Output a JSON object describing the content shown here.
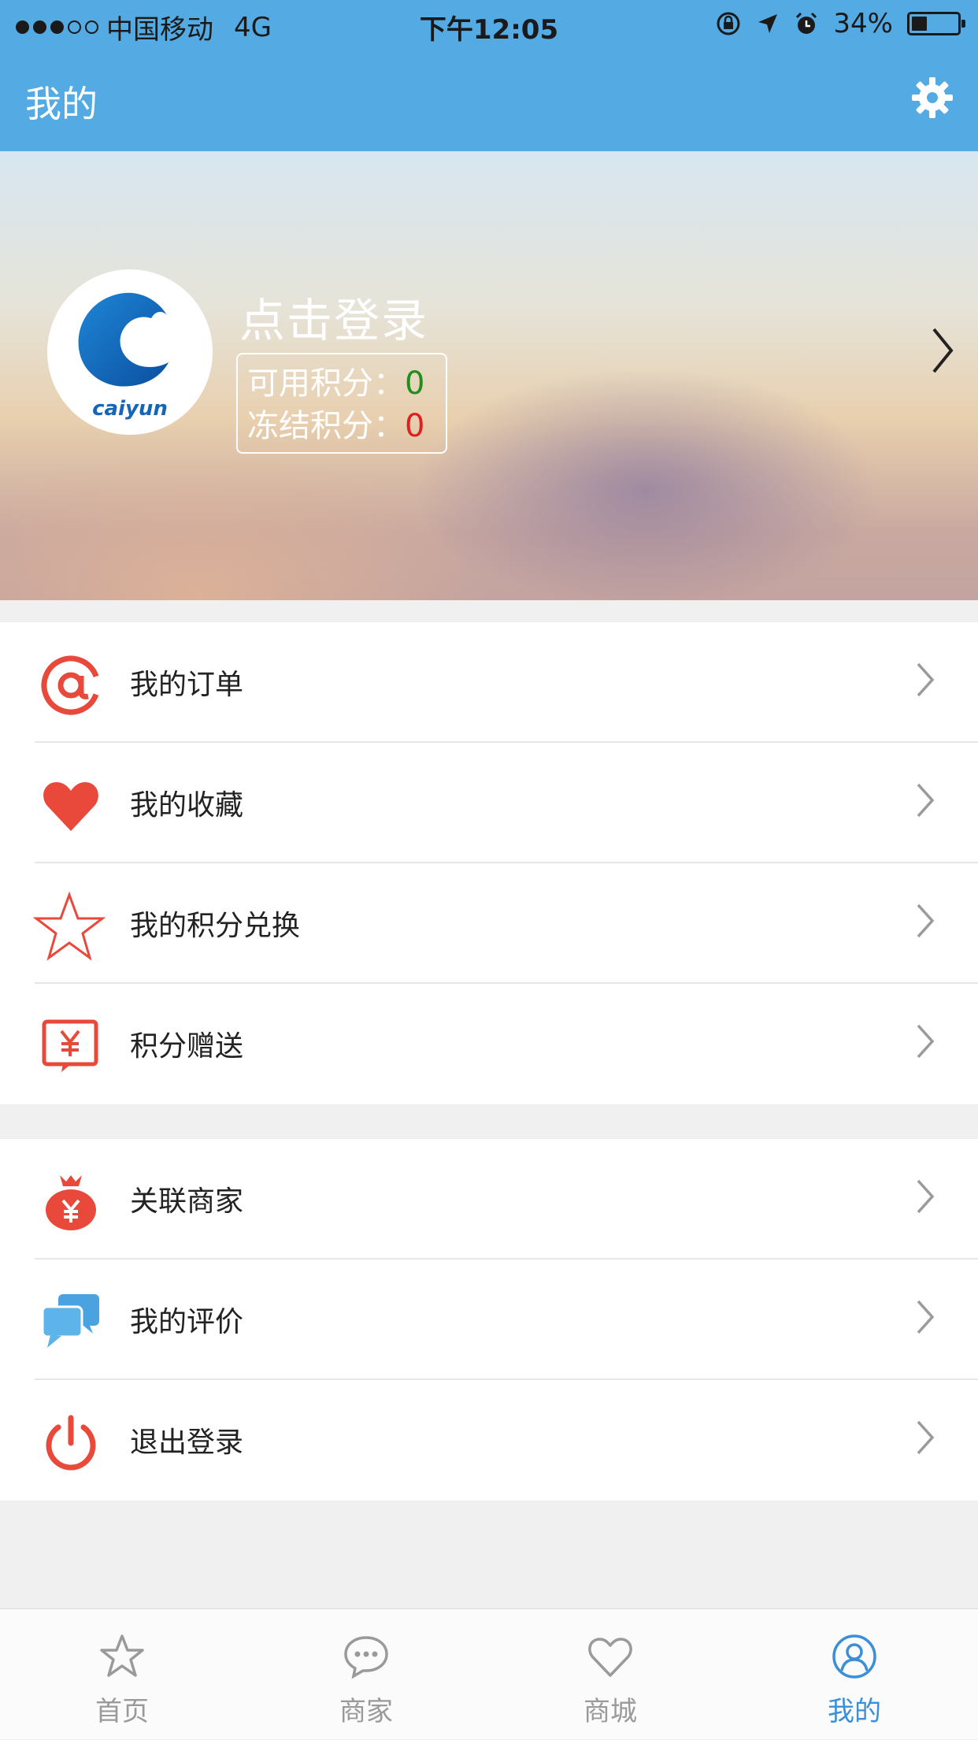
{
  "status_bar": {
    "carrier": "中国移动",
    "network": "4G",
    "time": "下午12:05",
    "battery": "34%",
    "battery_level": 0.34
  },
  "header": {
    "title": "我的",
    "settings_icon": "gear-icon"
  },
  "profile": {
    "logo_text": "caiyun",
    "login_prompt": "点击登录",
    "available_points_label": "可用积分：",
    "available_points_value": "0",
    "frozen_points_label": "冻结积分：",
    "frozen_points_value": "0"
  },
  "menu_group_1": [
    {
      "label": "我的订单",
      "icon": "at-sign-icon"
    },
    {
      "label": "我的收藏",
      "icon": "heart-icon"
    },
    {
      "label": "我的积分兑换",
      "icon": "star-icon"
    },
    {
      "label": "积分赠送",
      "icon": "yuan-card-icon"
    }
  ],
  "menu_group_2": [
    {
      "label": "关联商家",
      "icon": "money-bag-icon"
    },
    {
      "label": "我的评价",
      "icon": "chat-bubbles-icon"
    },
    {
      "label": "退出登录",
      "icon": "power-icon"
    }
  ],
  "tabbar": {
    "tabs": [
      {
        "label": "首页",
        "icon": "star-icon"
      },
      {
        "label": "商家",
        "icon": "chat-icon"
      },
      {
        "label": "商城",
        "icon": "heart-icon"
      },
      {
        "label": "我的",
        "icon": "user-icon"
      }
    ],
    "active_index": 3
  },
  "colors": {
    "header_bg": "#54aae3",
    "accent_red": "#e8493b",
    "accent_blue": "#3a8fd8",
    "points_green": "#1f8e1f",
    "points_red": "#e02020"
  }
}
